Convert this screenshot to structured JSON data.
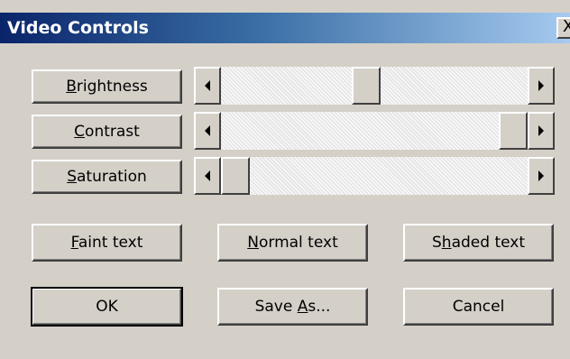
{
  "window": {
    "title": "Video Controls",
    "close_glyph": "X"
  },
  "sliders": [
    {
      "label_pre": "",
      "label_ul": "B",
      "label_post": "rightness",
      "value_pct": 47
    },
    {
      "label_pre": "",
      "label_ul": "C",
      "label_post": "ontrast",
      "value_pct": 100
    },
    {
      "label_pre": "",
      "label_ul": "S",
      "label_post": "aturation",
      "value_pct": 0
    }
  ],
  "text_buttons": [
    {
      "label_pre": "",
      "label_ul": "F",
      "label_post": "aint text"
    },
    {
      "label_pre": "",
      "label_ul": "N",
      "label_post": "ormal text"
    },
    {
      "label_pre": "S",
      "label_ul": "h",
      "label_post": "aded text"
    }
  ],
  "actions": {
    "ok": "OK",
    "save_pre": "Save ",
    "save_ul": "A",
    "save_post": "s...",
    "cancel": "Cancel"
  },
  "icons": {
    "left_arrow": "scroll-left-arrow-icon",
    "right_arrow": "scroll-right-arrow-icon"
  }
}
